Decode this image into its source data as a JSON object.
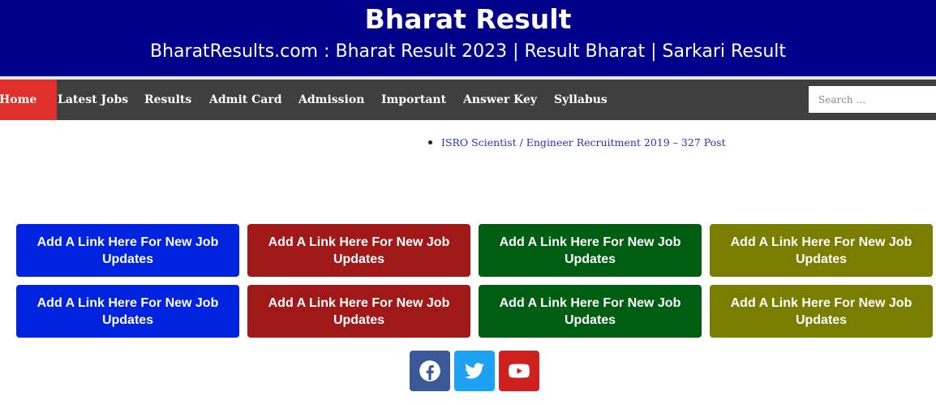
{
  "header": {
    "title": "Bharat Result",
    "tagline": "BharatResults.com : Bharat Result 2023 | Result Bharat | Sarkari Result"
  },
  "nav": {
    "items": [
      {
        "label": "Home",
        "active": true
      },
      {
        "label": "Latest Jobs"
      },
      {
        "label": "Results"
      },
      {
        "label": "Admit Card"
      },
      {
        "label": "Admission"
      },
      {
        "label": "Important"
      },
      {
        "label": "Answer Key"
      },
      {
        "label": "Syllabus"
      }
    ],
    "search_placeholder": "Search …"
  },
  "recent": {
    "items": [
      "ISRO Scientist / Engineer Recruitment 2019 – 327 Post"
    ]
  },
  "job_links": {
    "label": "Add A Link Here For New Job Updates",
    "colors": [
      "#0023e0",
      "#a01818",
      "#005e12",
      "#7a7e00"
    ]
  },
  "social": {
    "icons": [
      {
        "name": "facebook-icon",
        "color": "#3b5998"
      },
      {
        "name": "twitter-icon",
        "color": "#1da1f2"
      },
      {
        "name": "youtube-icon",
        "color": "#cd201f"
      }
    ]
  }
}
